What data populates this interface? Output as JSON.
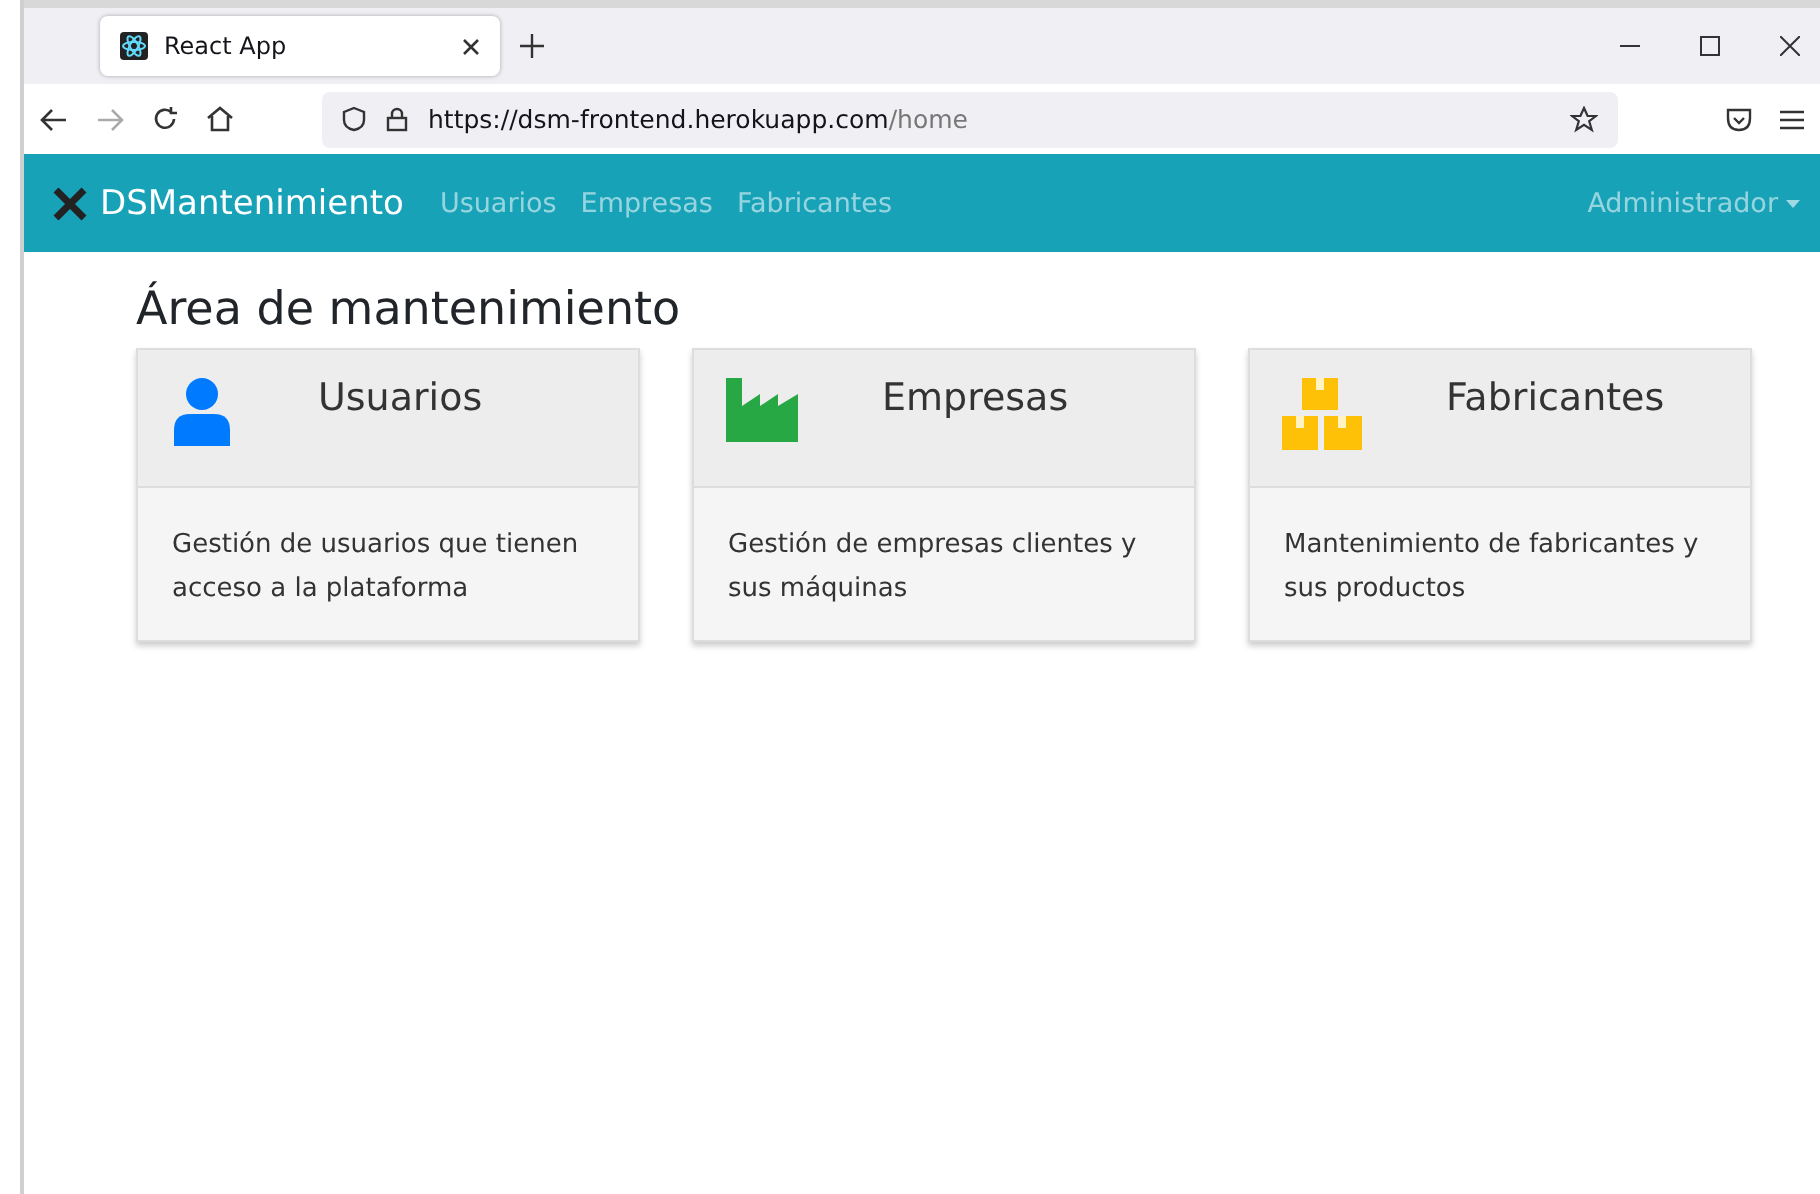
{
  "browser": {
    "tab_title": "React App",
    "url_host": "https://dsm-frontend.herokuapp.com",
    "url_path": "/home"
  },
  "navbar": {
    "brand": "DSMantenimiento",
    "links": [
      "Usuarios",
      "Empresas",
      "Fabricantes"
    ],
    "user_menu": "Administrador"
  },
  "page_title": "Área de mantenimiento",
  "cards": [
    {
      "kind": "user",
      "title": "Usuarios",
      "description": "Gestión de usuarios que tienen acceso a la plataforma"
    },
    {
      "kind": "factory",
      "title": "Empresas",
      "description": "Gestión de empresas clientes y sus máquinas"
    },
    {
      "kind": "boxes",
      "title": "Fabricantes",
      "description": "Mantenimiento de fabricantes y sus productos"
    }
  ]
}
